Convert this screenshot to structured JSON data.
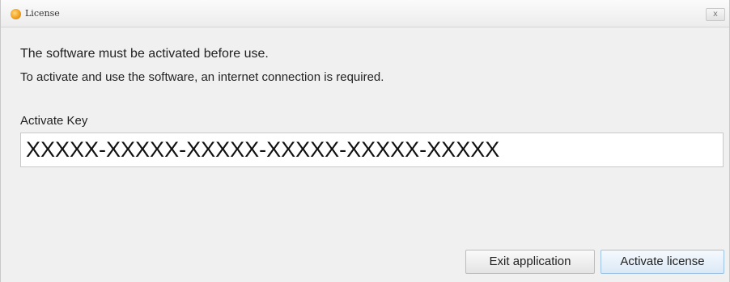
{
  "window": {
    "title": "License",
    "close_glyph": "x",
    "app_icon": "app-logo-icon"
  },
  "message": {
    "line1": "The software must be activated before use.",
    "line2": "To activate and use the software, an internet connection is required."
  },
  "key": {
    "label": "Activate Key",
    "value": "XXXXX-XXXXX-XXXXX-XXXXX-XXXXX-XXXXX"
  },
  "buttons": {
    "exit_label": "Exit application",
    "activate_label": "Activate license"
  }
}
